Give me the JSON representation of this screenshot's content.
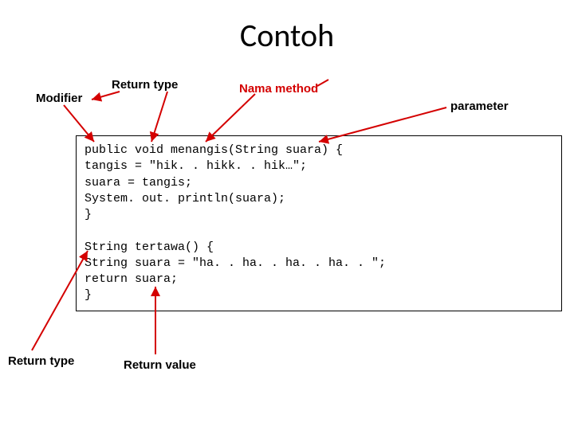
{
  "title": "Contoh",
  "labels": {
    "modifier": "Modifier",
    "return_type_top": "Return type",
    "nama_method": "Nama method",
    "parameter": "parameter",
    "return_type_bottom": "Return type",
    "return_value": "Return value"
  },
  "code": "public void menangis(String suara) {\ntangis = \"hik. . hikk. . hik…\";\nsuara = tangis;\nSystem. out. println(suara);\n}\n\nString tertawa() {\nString suara = \"ha. . ha. . ha. . ha. . \";\nreturn suara;\n}"
}
